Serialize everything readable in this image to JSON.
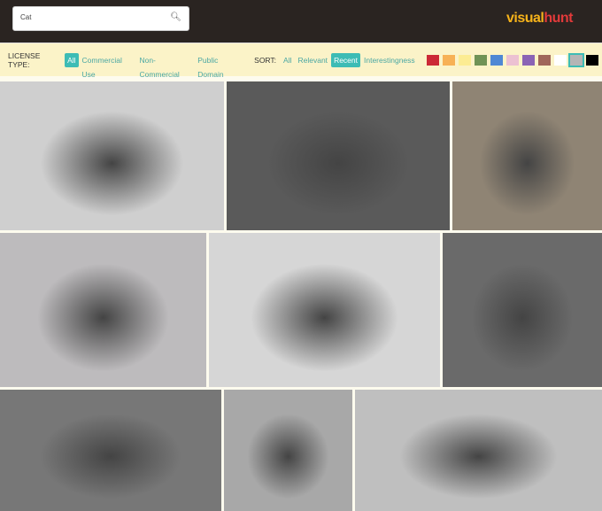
{
  "search": {
    "value": "Cat",
    "icon": "search-icon"
  },
  "logo": {
    "part1": "visual",
    "part2": "hunt"
  },
  "license": {
    "label": "LICENSE TYPE:",
    "options": [
      "All",
      "Commercial Use",
      "Non-Commercial",
      "Public Domain"
    ],
    "selected": "All"
  },
  "sort": {
    "label": "SORT:",
    "options": [
      "All",
      "Relevant",
      "Recent",
      "Interestingness"
    ],
    "selected": "Recent"
  },
  "colors": {
    "swatches": [
      "#cc2936",
      "#f7b155",
      "#fcec93",
      "#6f9356",
      "#4f88d4",
      "#ecc1d2",
      "#8a63b5",
      "#a0665a",
      "#ffffff",
      "#b5b5b5",
      "#000000"
    ],
    "selected": "#b5b5b5"
  },
  "photos": [
    {
      "desc": "black cat lying on windowsill",
      "tone": "#cfcfcf"
    },
    {
      "desc": "tabby cat on gravel",
      "tone": "#5a5a5a"
    },
    {
      "desc": "cat eye close-up",
      "tone": "#8f8474"
    },
    {
      "desc": "grey kitten on blanket",
      "tone": "#bdbbbd"
    },
    {
      "desc": "grey cat looking up",
      "tone": "#d6d6d6"
    },
    {
      "desc": "tabby cat face",
      "tone": "#6a6a6a"
    },
    {
      "desc": "woman with cat",
      "tone": "#777777"
    },
    {
      "desc": "tabby cat with yellow eyes",
      "tone": "#a8a8a8"
    },
    {
      "desc": "grumpy grey cat",
      "tone": "#bfbfbf"
    }
  ]
}
